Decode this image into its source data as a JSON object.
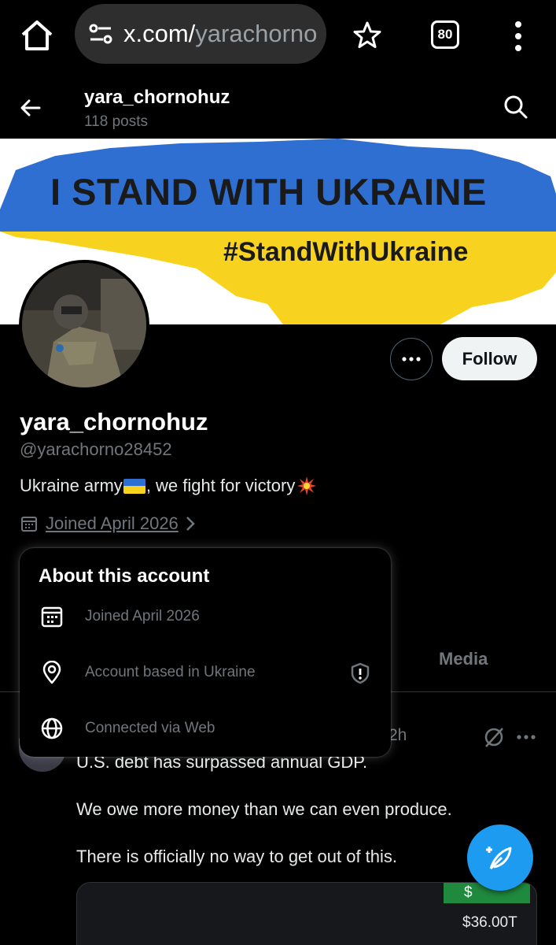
{
  "browser": {
    "url_host": "x.com/",
    "url_path": "yarachorno",
    "tab_count": "80"
  },
  "header": {
    "title": "yara_chornohuz",
    "posts_count": "118 posts"
  },
  "banner": {
    "headline": "I STAND WITH UKRAINE",
    "hashtag": "#StandWithUkraine",
    "colors": {
      "blue": "#2f6fd1",
      "yellow": "#f7d21e"
    }
  },
  "profile": {
    "display_name": "yara_chornohuz",
    "handle": "@yarachorno28452",
    "bio_before": "Ukraine army",
    "bio_after": ", we fight for victory",
    "joined": "Joined April 2026",
    "follow_label": "Follow"
  },
  "tabs": {
    "media": "Media"
  },
  "popover": {
    "title": "About this account",
    "rows": [
      {
        "icon": "calendar-icon",
        "label": "Joined April 2026"
      },
      {
        "icon": "location-pin-icon",
        "label": "Account based in Ukraine"
      },
      {
        "icon": "globe-icon",
        "label": "Connected via Web"
      }
    ]
  },
  "post": {
    "time": "2h",
    "lines": [
      "U.S. debt has surpassed annual GDP.",
      "We owe more money than we can even produce.",
      "There is officially no way to get out of this."
    ],
    "card_amount": "$36.00T",
    "card_partial": "$"
  },
  "colors": {
    "accent": "#1d9bf0",
    "background": "#000000",
    "muted_text": "#71767b"
  }
}
